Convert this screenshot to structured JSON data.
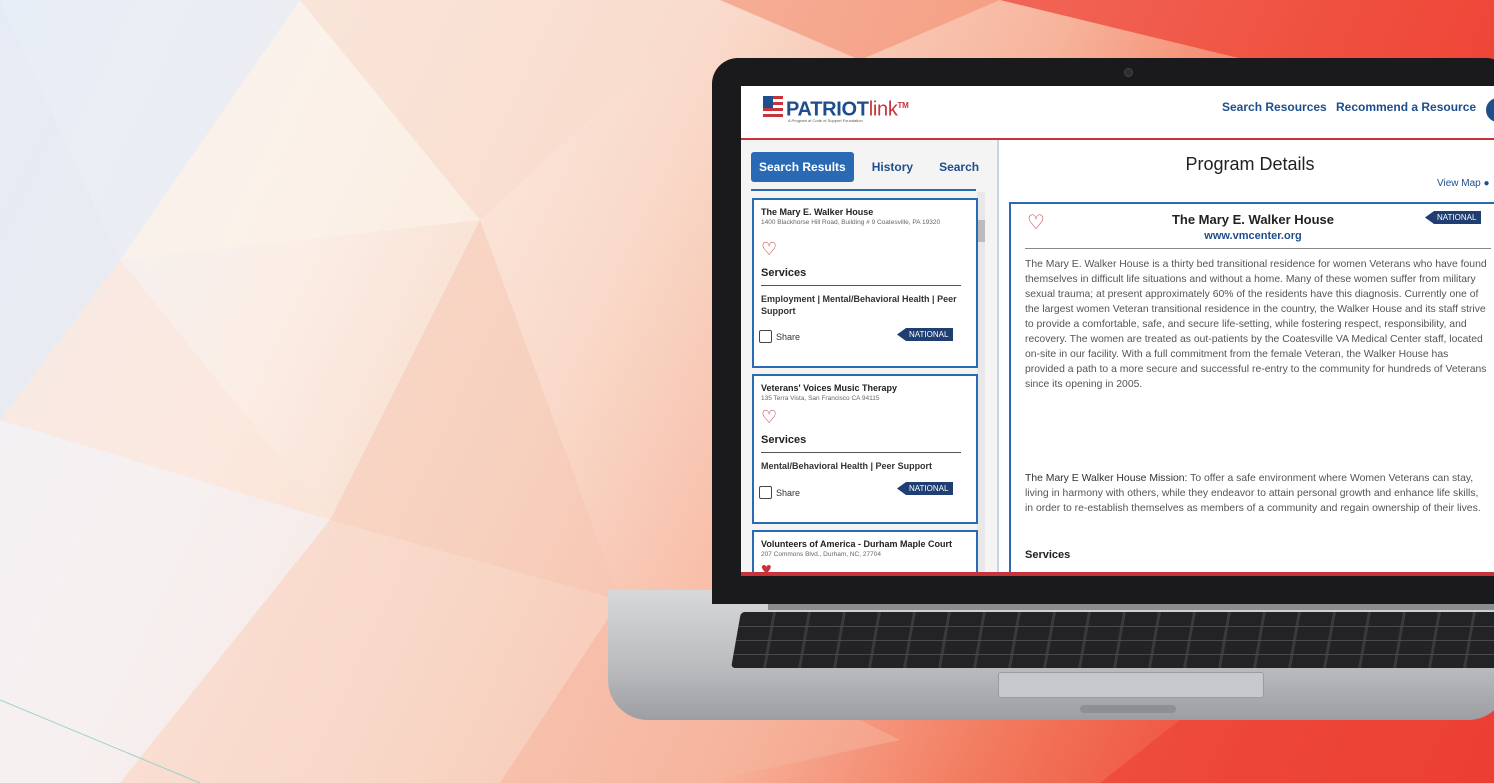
{
  "header": {
    "logo_main": "PATRIOT",
    "logo_link": "link",
    "logo_tm": "TM",
    "logo_sub": "A Program of Code of Support Foundation",
    "nav": [
      "Search Resources",
      "Recommend a Resource"
    ]
  },
  "left_panel": {
    "tabs": [
      "Search Results",
      "History",
      "Search"
    ],
    "cards": [
      {
        "title": "The Mary E. Walker House",
        "address": "1400 Blackhorse Hill Road, Building # 9 Coatesville, PA 19320",
        "services_heading": "Services",
        "services": "Employment | Mental/Behavioral Health | Peer Support",
        "share": "Share",
        "badge": "NATIONAL"
      },
      {
        "title": "Veterans' Voices Music Therapy",
        "address": "135 Terra Vista, San Francisco CA 94115",
        "services_heading": "Services",
        "services": "Mental/Behavioral Health | Peer Support",
        "share": "Share",
        "badge": "NATIONAL"
      },
      {
        "title": "Volunteers of America - Durham Maple Court",
        "address": "207 Commons Blvd., Durham, NC, 27704"
      }
    ]
  },
  "right_panel": {
    "title": "Program Details",
    "view_map": "View Map",
    "program_name": "The Mary E. Walker House",
    "url": "www.vmcenter.org",
    "badge": "NATIONAL",
    "description": "The Mary E. Walker House is a thirty bed transitional residence for women Veterans who have found themselves in difficult life situations and without a home. Many of these women suffer from military sexual trauma; at present approximately 60% of the residents have this diagnosis. Currently one of the largest women Veteran transitional residence in the country, the Walker House and its staff strive to provide a comfortable, safe, and secure life-setting, while fostering respect, responsibility, and recovery. The women are treated as out-patients by the Coatesville VA Medical Center staff, located on-site in our facility. With a full commitment from the female Veteran, the Walker House has provided a path to a more secure and successful re-entry to the community for hundreds of Veterans since its opening in 2005.",
    "mission_label": "The Mary E Walker House Mission:",
    "mission_text": " To offer a safe environment where Women Veterans can stay, living in harmony with others, while they endeavor to attain personal growth and enhance life skills, in order to re-establish themselves as members of a community and regain ownership of their lives.",
    "services_heading": "Services"
  },
  "colors": {
    "brand_blue": "#1f4e8c",
    "brand_red": "#c8323a",
    "tab_blue": "#2a6ab5",
    "badge_navy": "#1f3f73"
  },
  "icons": [
    "flag-logo-icon",
    "heart-icon",
    "map-pin-icon",
    "user-avatar-icon",
    "checkbox-icon"
  ]
}
